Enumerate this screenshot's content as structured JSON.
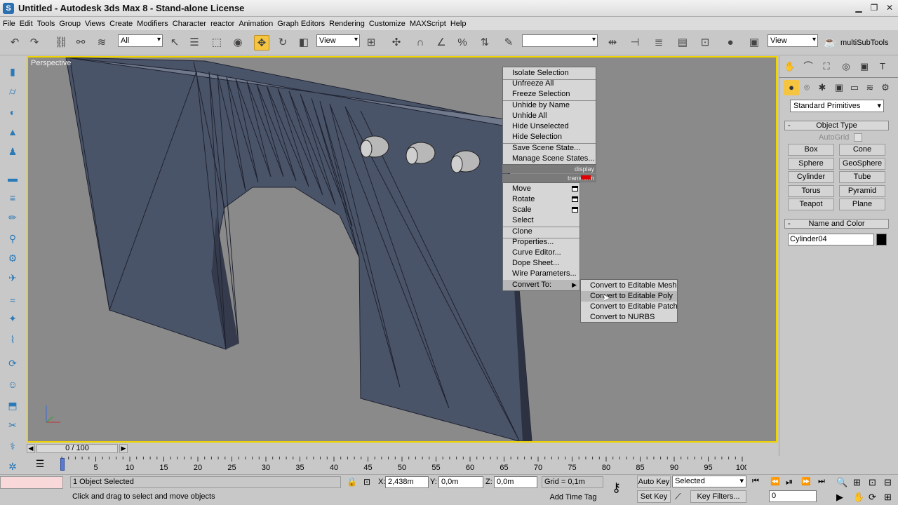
{
  "window": {
    "title": "Untitled - Autodesk 3ds Max 8 - Stand-alone License",
    "app_icon": "3ds-max-logo-icon",
    "controls": [
      "minimize",
      "maximize",
      "close"
    ]
  },
  "menubar": {
    "items": [
      "File",
      "Edit",
      "Tools",
      "Group",
      "Views",
      "Create",
      "Modifiers",
      "Character",
      "reactor",
      "Animation",
      "Graph Editors",
      "Rendering",
      "Customize",
      "MAXScript",
      "Help"
    ]
  },
  "toolbar": {
    "selection_filter": "All",
    "reference_coord": "View",
    "named_selection": "",
    "view_dropdown": "View",
    "plugin_label": "multiSubTools",
    "active_tool": "select-and-move"
  },
  "viewport": {
    "label": "Perspective",
    "border_color": "#f0d400",
    "background": "#8a8a8a",
    "object_color": "#4a5468"
  },
  "quadmenu": {
    "display_header": "display",
    "transform_header": "transform",
    "display_items": [
      "Isolate Selection",
      "Unfreeze All",
      "Freeze Selection",
      "Unhide by Name",
      "Unhide All",
      "Hide Unselected",
      "Hide Selection",
      "Save Scene State...",
      "Manage Scene States..."
    ],
    "transform_items": [
      "Move",
      "Rotate",
      "Scale",
      "Select",
      "Clone",
      "Properties...",
      "Curve Editor...",
      "Dope Sheet...",
      "Wire Parameters...",
      "Convert To:"
    ],
    "submenu": [
      "Convert to Editable Mesh",
      "Convert to Editable Poly",
      "Convert to Editable Patch",
      "Convert to NURBS"
    ],
    "highlighted_sub": "Convert to Editable Poly"
  },
  "command_panel": {
    "category": "Standard Primitives",
    "object_type_title": "Object Type",
    "autogrid_label": "AutoGrid",
    "buttons": [
      "Box",
      "Cone",
      "Sphere",
      "GeoSphere",
      "Cylinder",
      "Tube",
      "Torus",
      "Pyramid",
      "Teapot",
      "Plane"
    ],
    "name_color_title": "Name and Color",
    "object_name": "Cylinder04",
    "object_color": "#000000"
  },
  "timeline": {
    "frame_display": "0 / 100",
    "ticks": [
      "0",
      "5",
      "10",
      "15",
      "20",
      "25",
      "30",
      "35",
      "40",
      "45",
      "50",
      "55",
      "60",
      "65",
      "70",
      "75",
      "80",
      "85",
      "90",
      "95",
      "100"
    ]
  },
  "status": {
    "selection_info": "1 Object Selected",
    "prompt": "Click and drag to select and move objects",
    "x_label": "X:",
    "x_value": "2,438m",
    "y_label": "Y:",
    "y_value": "0,0m",
    "z_label": "Z:",
    "z_value": "0,0m",
    "grid": "Grid = 0,1m",
    "add_time_tag": "Add Time Tag",
    "auto_key": "Auto Key",
    "set_key": "Set Key",
    "key_mode": "Selected",
    "key_filters": "Key Filters...",
    "current_frame": "0"
  }
}
